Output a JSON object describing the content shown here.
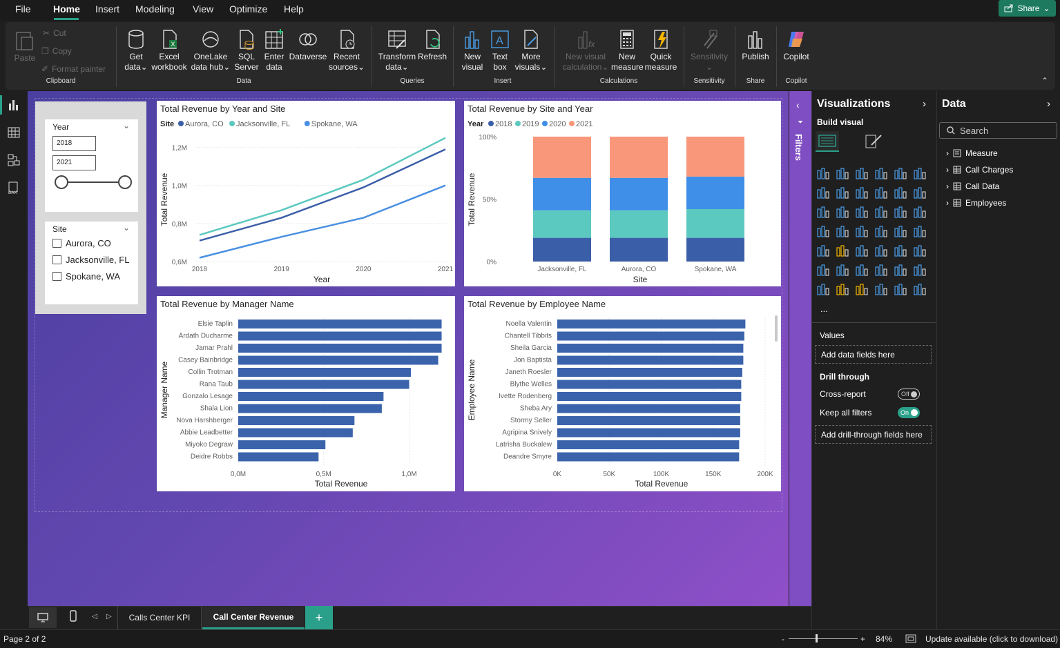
{
  "menu": {
    "items": [
      "File",
      "Home",
      "Insert",
      "Modeling",
      "View",
      "Optimize",
      "Help"
    ],
    "active": "Home",
    "share_label": "Share"
  },
  "ribbon": {
    "clipboard": {
      "paste": "Paste",
      "cut": "Cut",
      "copy": "Copy",
      "format_painter": "Format painter",
      "group": "Clipboard"
    },
    "data": {
      "get_data_1": "Get",
      "get_data_2": "data",
      "excel_1": "Excel",
      "excel_2": "workbook",
      "onelake_1": "OneLake",
      "onelake_2": "data hub",
      "sql_1": "SQL",
      "sql_2": "Server",
      "enter_1": "Enter",
      "enter_2": "data",
      "dataverse": "Dataverse",
      "recent_1": "Recent",
      "recent_2": "sources",
      "group": "Data"
    },
    "queries": {
      "transform_1": "Transform",
      "transform_2": "data",
      "refresh": "Refresh",
      "group": "Queries"
    },
    "insert": {
      "new_visual_1": "New",
      "new_visual_2": "visual",
      "text_box_1": "Text",
      "text_box_2": "box",
      "more_visuals_1": "More",
      "more_visuals_2": "visuals",
      "group": "Insert"
    },
    "calculations": {
      "new_visual_calc_1": "New visual",
      "new_visual_calc_2": "calculation",
      "new_measure_1": "New",
      "new_measure_2": "measure",
      "quick_measure_1": "Quick",
      "quick_measure_2": "measure",
      "group": "Calculations"
    },
    "sensitivity": {
      "label": "Sensitivity",
      "group": "Sensitivity"
    },
    "share": {
      "publish": "Publish",
      "group": "Share"
    },
    "copilot": {
      "label": "Copilot",
      "group": "Copilot"
    }
  },
  "slicers": {
    "year": {
      "title": "Year",
      "from": "2018",
      "to": "2021"
    },
    "site": {
      "title": "Site",
      "options": [
        "Aurora, CO",
        "Jacksonville, FL",
        "Spokane, WA"
      ]
    }
  },
  "colors": {
    "aurora": "#3b5ea8",
    "jacksonville": "#5bc9bf",
    "spokane": "#4a90e2",
    "y2018": "#3b5ea8",
    "y2019": "#5bc9bf",
    "y2020": "#3f8ee8",
    "y2021": "#f8977a",
    "bar": "#3b63ac"
  },
  "chart_data": [
    {
      "type": "line",
      "title": "Total Revenue by Year and Site",
      "legend_title": "Site",
      "xlabel": "Year",
      "ylabel": "Total Revenue",
      "x": [
        "2018",
        "2019",
        "2020",
        "2021"
      ],
      "y_ticks": [
        "0,6M",
        "0,8M",
        "1,0M",
        "1,2M"
      ],
      "ylim": [
        0.6,
        1.3
      ],
      "series": [
        {
          "name": "Aurora, CO",
          "values": [
            0.71,
            0.83,
            0.99,
            1.19
          ]
        },
        {
          "name": "Jacksonville, FL",
          "values": [
            0.74,
            0.87,
            1.03,
            1.25
          ]
        },
        {
          "name": "Spokane, WA",
          "values": [
            0.62,
            0.73,
            0.83,
            1.0
          ]
        }
      ]
    },
    {
      "type": "bar",
      "stacked_percent": true,
      "title": "Total Revenue by Site and Year",
      "legend_title": "Year",
      "xlabel": "Site",
      "ylabel": "Total Revenue",
      "categories": [
        "Jacksonville, FL",
        "Aurora, CO",
        "Spokane, WA"
      ],
      "y_ticks": [
        "0%",
        "50%",
        "100%"
      ],
      "series": [
        {
          "name": "2018",
          "values": [
            19,
            19,
            19
          ]
        },
        {
          "name": "2019",
          "values": [
            22,
            22,
            23
          ]
        },
        {
          "name": "2020",
          "values": [
            26,
            26,
            26
          ]
        },
        {
          "name": "2021",
          "values": [
            33,
            33,
            32
          ]
        }
      ]
    },
    {
      "type": "bar",
      "orientation": "horizontal",
      "title": "Total Revenue by Manager Name",
      "xlabel": "Total Revenue",
      "ylabel": "Manager Name",
      "x_ticks": [
        "0,0M",
        "0,5M",
        "1,0M"
      ],
      "xlim": [
        0,
        1.2
      ],
      "categories": [
        "Elsie Taplin",
        "Ardath Ducharme",
        "Jamar Prahl",
        "Casey Bainbridge",
        "Collin Trotman",
        "Rana Taub",
        "Gonzalo Lesage",
        "Shala Lion",
        "Nova Harshberger",
        "Abbie Leadbetter",
        "Miyoko Degraw",
        "Deidre Robbs"
      ],
      "values": [
        1.19,
        1.19,
        1.19,
        1.17,
        1.01,
        1.0,
        0.85,
        0.84,
        0.68,
        0.67,
        0.51,
        0.47
      ]
    },
    {
      "type": "bar",
      "orientation": "horizontal",
      "title": "Total Revenue by Employee Name",
      "xlabel": "Total Revenue",
      "ylabel": "Employee Name",
      "x_ticks": [
        "0K",
        "50K",
        "100K",
        "150K",
        "200K"
      ],
      "xlim": [
        0,
        200
      ],
      "categories": [
        "Noella Valentin",
        "Chantell Tibbits",
        "Sheila Garcia",
        "Jon Baptista",
        "Janeth Roesler",
        "Blythe Welles",
        "Ivette Rodenberg",
        "Sheba Ary",
        "Stormy Seller",
        "Agripina Snively",
        "Latrisha Buckalew",
        "Deandre Smyre"
      ],
      "values": [
        181,
        180,
        179,
        179,
        178,
        177,
        177,
        176,
        176,
        176,
        175,
        175
      ]
    }
  ],
  "filters_label": "Filters",
  "viz_pane": {
    "title": "Visualizations",
    "build_visual": "Build visual",
    "values_label": "Values",
    "add_data_fields": "Add data fields here",
    "drill_through": "Drill through",
    "cross_report": "Cross-report",
    "cross_report_state": "Off",
    "keep_all_filters": "Keep all filters",
    "keep_all_filters_state": "On",
    "add_drill_fields": "Add drill-through fields here",
    "more": "..."
  },
  "data_pane": {
    "title": "Data",
    "search_placeholder": "Search",
    "tables": [
      "Measure",
      "Call Charges",
      "Call Data",
      "Employees"
    ]
  },
  "tabs": {
    "pages": [
      "Calls Center KPI",
      "Call Center Revenue"
    ],
    "active": "Call Center Revenue",
    "add": "+"
  },
  "status": {
    "page": "Page 2 of 2",
    "zoom": "84%",
    "update": "Update available (click to download)",
    "zoom_minus": "-",
    "zoom_plus": "+"
  }
}
